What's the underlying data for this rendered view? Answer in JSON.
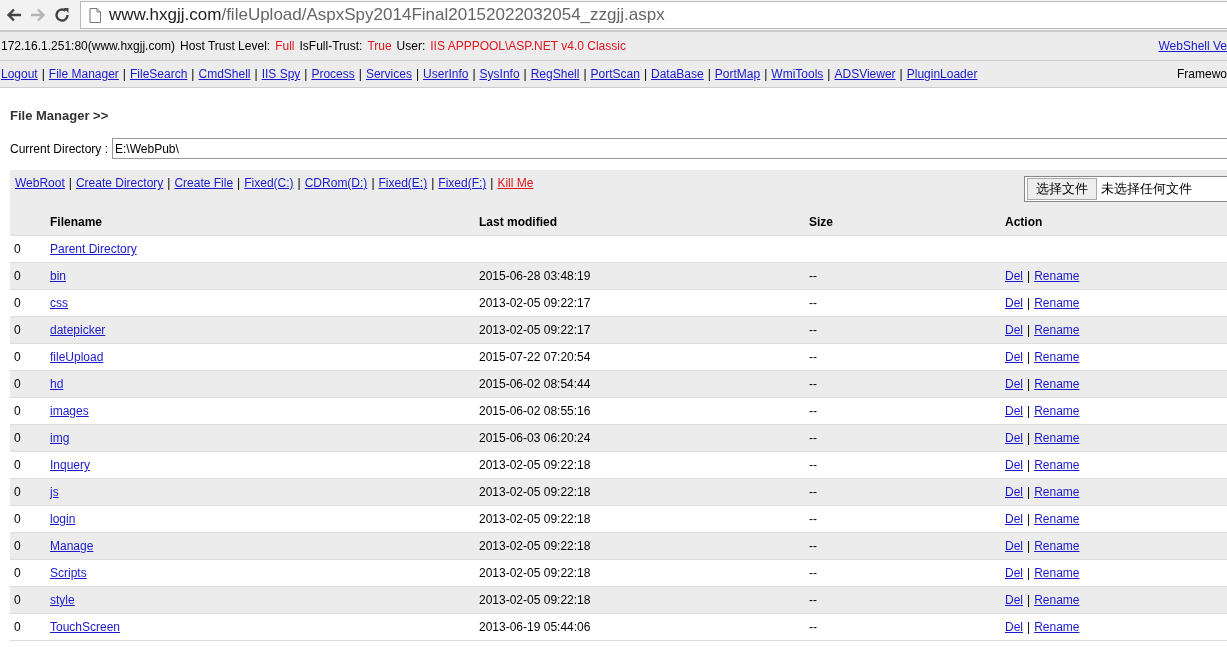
{
  "browser": {
    "back": {
      "disabled": false
    },
    "forward": {
      "disabled": true
    },
    "url_host": "www.hxgjj.com",
    "url_path": "/fileUpload/AspxSpy2014Final20152022032054_zzgjj.aspx"
  },
  "info_bar": {
    "items": [
      {
        "kind": "plain",
        "text": "172.16.1.251:80(www.hxgjj.com)"
      },
      {
        "kind": "plain",
        "text": "Host Trust Level:"
      },
      {
        "kind": "alert",
        "text": "Full"
      },
      {
        "kind": "plain",
        "text": "IsFull-Trust:"
      },
      {
        "kind": "alert",
        "text": "True"
      },
      {
        "kind": "plain",
        "text": "User:"
      },
      {
        "kind": "alert",
        "text": "IIS APPPOOL\\ASP.NET v4.0 Classic"
      }
    ],
    "version_link": "WebShell Ve"
  },
  "nav": {
    "items": [
      {
        "kind": "link",
        "text": "Logout"
      },
      {
        "kind": "sep",
        "text": "|"
      },
      {
        "kind": "link",
        "text": "File Manager"
      },
      {
        "kind": "sep",
        "text": "|"
      },
      {
        "kind": "link",
        "text": "FileSearch"
      },
      {
        "kind": "sep",
        "text": "|"
      },
      {
        "kind": "link",
        "text": "CmdShell"
      },
      {
        "kind": "sep",
        "text": "|"
      },
      {
        "kind": "link",
        "text": "IIS Spy"
      },
      {
        "kind": "sep",
        "text": "|"
      },
      {
        "kind": "link",
        "text": "Process"
      },
      {
        "kind": "sep",
        "text": "|"
      },
      {
        "kind": "link",
        "text": "Services"
      },
      {
        "kind": "sep",
        "text": "|"
      },
      {
        "kind": "link",
        "text": "UserInfo"
      },
      {
        "kind": "sep",
        "text": "|"
      },
      {
        "kind": "link",
        "text": "SysInfo"
      },
      {
        "kind": "sep",
        "text": "|"
      },
      {
        "kind": "link",
        "text": "RegShell"
      },
      {
        "kind": "sep",
        "text": "|"
      },
      {
        "kind": "link",
        "text": "PortScan"
      },
      {
        "kind": "sep",
        "text": "|"
      },
      {
        "kind": "link",
        "text": "DataBase"
      },
      {
        "kind": "sep",
        "text": "|"
      },
      {
        "kind": "link",
        "text": "PortMap"
      },
      {
        "kind": "sep",
        "text": "|"
      },
      {
        "kind": "link",
        "text": "WmiTools"
      },
      {
        "kind": "sep",
        "text": "|"
      },
      {
        "kind": "link",
        "text": "ADSViewer"
      },
      {
        "kind": "sep",
        "text": "|"
      },
      {
        "kind": "link",
        "text": "PluginLoader"
      }
    ],
    "framework": "Framewo"
  },
  "heading": "File Manager >>",
  "current_directory": {
    "label": "Current Directory :",
    "value": "E:\\WebPub\\"
  },
  "toolbar": {
    "items": [
      {
        "kind": "link",
        "text": "WebRoot"
      },
      {
        "kind": "sep",
        "text": "|"
      },
      {
        "kind": "link",
        "text": "Create Directory"
      },
      {
        "kind": "sep",
        "text": "|"
      },
      {
        "kind": "link",
        "text": "Create File"
      },
      {
        "kind": "sep",
        "text": "|"
      },
      {
        "kind": "link",
        "text": "Fixed(C:)"
      },
      {
        "kind": "sep",
        "text": "|"
      },
      {
        "kind": "link",
        "text": "CDRom(D:)"
      },
      {
        "kind": "sep",
        "text": "|"
      },
      {
        "kind": "link",
        "text": "Fixed(E:)"
      },
      {
        "kind": "sep",
        "text": "|"
      },
      {
        "kind": "link",
        "text": "Fixed(F:)"
      },
      {
        "kind": "sep",
        "text": "|"
      },
      {
        "kind": "danger",
        "text": "Kill Me"
      }
    ],
    "file_button": "选择文件",
    "file_status": "未选择任何文件"
  },
  "table": {
    "columns": [
      "",
      "Filename",
      "Last modified",
      "Size",
      "Action"
    ],
    "rows": [
      {
        "column_1": "0",
        "name": "Parent Directory",
        "modified": "",
        "size": "",
        "actions": []
      },
      {
        "column_1": "0",
        "name": "bin",
        "modified": "2015-06-28 03:48:19",
        "size": "--",
        "actions": [
          "Del",
          "|",
          "Rename"
        ]
      },
      {
        "column_1": "0",
        "name": "css",
        "modified": "2013-02-05 09:22:17",
        "size": "--",
        "actions": [
          "Del",
          "|",
          "Rename"
        ]
      },
      {
        "column_1": "0",
        "name": "datepicker",
        "modified": "2013-02-05 09:22:17",
        "size": "--",
        "actions": [
          "Del",
          "|",
          "Rename"
        ]
      },
      {
        "column_1": "0",
        "name": "fileUpload",
        "modified": "2015-07-22 07:20:54",
        "size": "--",
        "actions": [
          "Del",
          "|",
          "Rename"
        ]
      },
      {
        "column_1": "0",
        "name": "hd",
        "modified": "2015-06-02 08:54:44",
        "size": "--",
        "actions": [
          "Del",
          "|",
          "Rename"
        ]
      },
      {
        "column_1": "0",
        "name": "images",
        "modified": "2015-06-02 08:55:16",
        "size": "--",
        "actions": [
          "Del",
          "|",
          "Rename"
        ]
      },
      {
        "column_1": "0",
        "name": "img",
        "modified": "2015-06-03 06:20:24",
        "size": "--",
        "actions": [
          "Del",
          "|",
          "Rename"
        ]
      },
      {
        "column_1": "0",
        "name": "Inquery",
        "modified": "2013-02-05 09:22:18",
        "size": "--",
        "actions": [
          "Del",
          "|",
          "Rename"
        ]
      },
      {
        "column_1": "0",
        "name": "js",
        "modified": "2013-02-05 09:22:18",
        "size": "--",
        "actions": [
          "Del",
          "|",
          "Rename"
        ]
      },
      {
        "column_1": "0",
        "name": "login",
        "modified": "2013-02-05 09:22:18",
        "size": "--",
        "actions": [
          "Del",
          "|",
          "Rename"
        ]
      },
      {
        "column_1": "0",
        "name": "Manage",
        "modified": "2013-02-05 09:22:18",
        "size": "--",
        "actions": [
          "Del",
          "|",
          "Rename"
        ]
      },
      {
        "column_1": "0",
        "name": "Scripts",
        "modified": "2013-02-05 09:22:18",
        "size": "--",
        "actions": [
          "Del",
          "|",
          "Rename"
        ]
      },
      {
        "column_1": "0",
        "name": "style",
        "modified": "2013-02-05 09:22:18",
        "size": "--",
        "actions": [
          "Del",
          "|",
          "Rename"
        ]
      },
      {
        "column_1": "0",
        "name": "TouchScreen",
        "modified": "2013-06-19 05:44:06",
        "size": "--",
        "actions": [
          "Del",
          "|",
          "Rename"
        ]
      }
    ]
  }
}
